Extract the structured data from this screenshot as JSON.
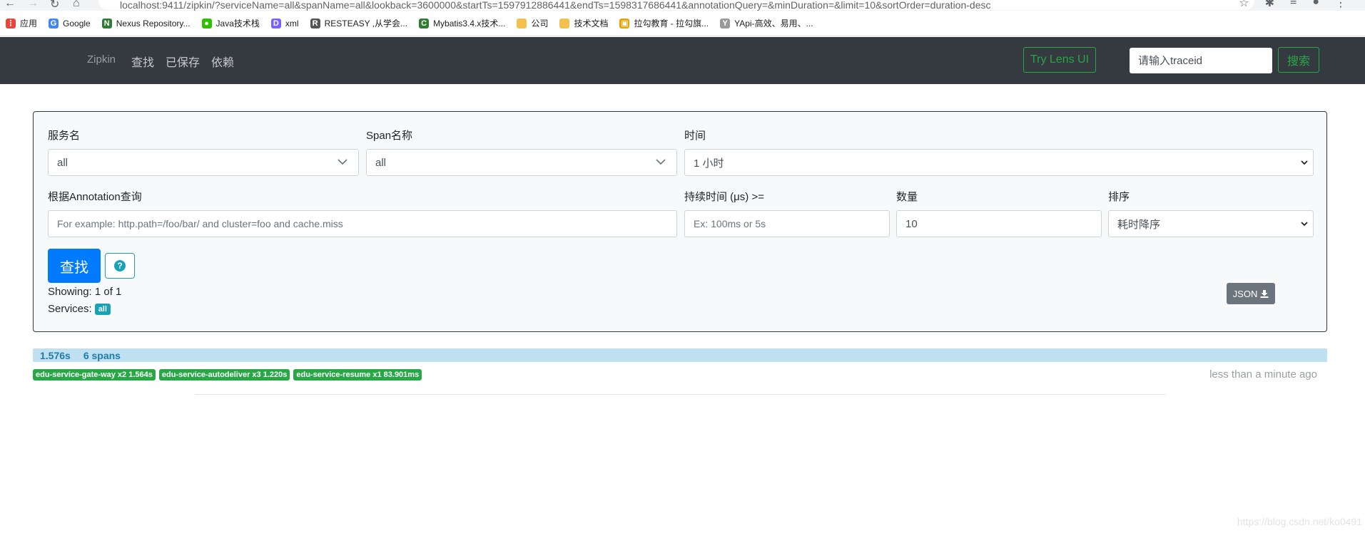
{
  "browser": {
    "url": "localhost:9411/zipkin/?serviceName=all&spanName=all&lookback=3600000&startTs=1597912886441&endTs=1598317686441&annotationQuery=&minDuration=&limit=10&sortOrder=duration-desc",
    "bookmarks": [
      {
        "label": "应用",
        "icon": "apps-grid-icon",
        "color": "#e8453c"
      },
      {
        "label": "Google",
        "icon": "google-icon",
        "color": "#4285f4"
      },
      {
        "label": "Nexus Repository...",
        "icon": "nexus-icon",
        "color": "#2e7d32"
      },
      {
        "label": "Java技术栈",
        "icon": "wechat-icon",
        "color": "#2dc100"
      },
      {
        "label": "xml",
        "icon": "xml-icon",
        "color": "#7b61ff"
      },
      {
        "label": "RESTEASY ,从学会...",
        "icon": "resteasy-icon",
        "color": "#555555"
      },
      {
        "label": "Mybatis3.4.x技术...",
        "icon": "mybatis-icon",
        "color": "#2e7d32"
      },
      {
        "label": "公司",
        "icon": "folder-icon",
        "color": "#f2c14e"
      },
      {
        "label": "技术文档",
        "icon": "folder-icon",
        "color": "#f2c14e"
      },
      {
        "label": "拉勾教育 - 拉勾旗...",
        "icon": "lagou-icon",
        "color": "#e5a400"
      },
      {
        "label": "YApi-高效、易用、...",
        "icon": "yapi-icon",
        "color": "#999999"
      }
    ]
  },
  "navbar": {
    "brand": "Zipkin",
    "links": [
      "查找",
      "已保存",
      "依赖"
    ],
    "lens_button": "Try Lens UI",
    "trace_placeholder": "请输入traceid",
    "search_button": "搜索"
  },
  "form": {
    "service_label": "服务名",
    "service_value": "all",
    "span_label": "Span名称",
    "span_value": "all",
    "time_label": "时间",
    "time_value": "1 小时",
    "annotation_label": "根据Annotation查询",
    "annotation_placeholder": "For example: http.path=/foo/bar/ and cluster=foo and cache.miss",
    "duration_label": "持续时间 (μs) >=",
    "duration_placeholder": "Ex: 100ms or 5s",
    "limit_label": "数量",
    "limit_value": "10",
    "sort_label": "排序",
    "sort_value": "耗时降序",
    "find_button": "查找",
    "help_icon": "?",
    "showing": "Showing: 1 of 1",
    "services_label": "Services:",
    "services_badge": "all",
    "json_button": "JSON"
  },
  "result": {
    "duration": "1.576s",
    "spans": "6 spans",
    "progress_fraction": 1.0,
    "service_badges": [
      "edu-service-gate-way x2 1.564s",
      "edu-service-autodeliver x3 1.220s",
      "edu-service-resume x1 83.901ms"
    ],
    "time_ago": "less than a minute ago"
  },
  "watermark": "https://blog.csdn.net/ko0491"
}
